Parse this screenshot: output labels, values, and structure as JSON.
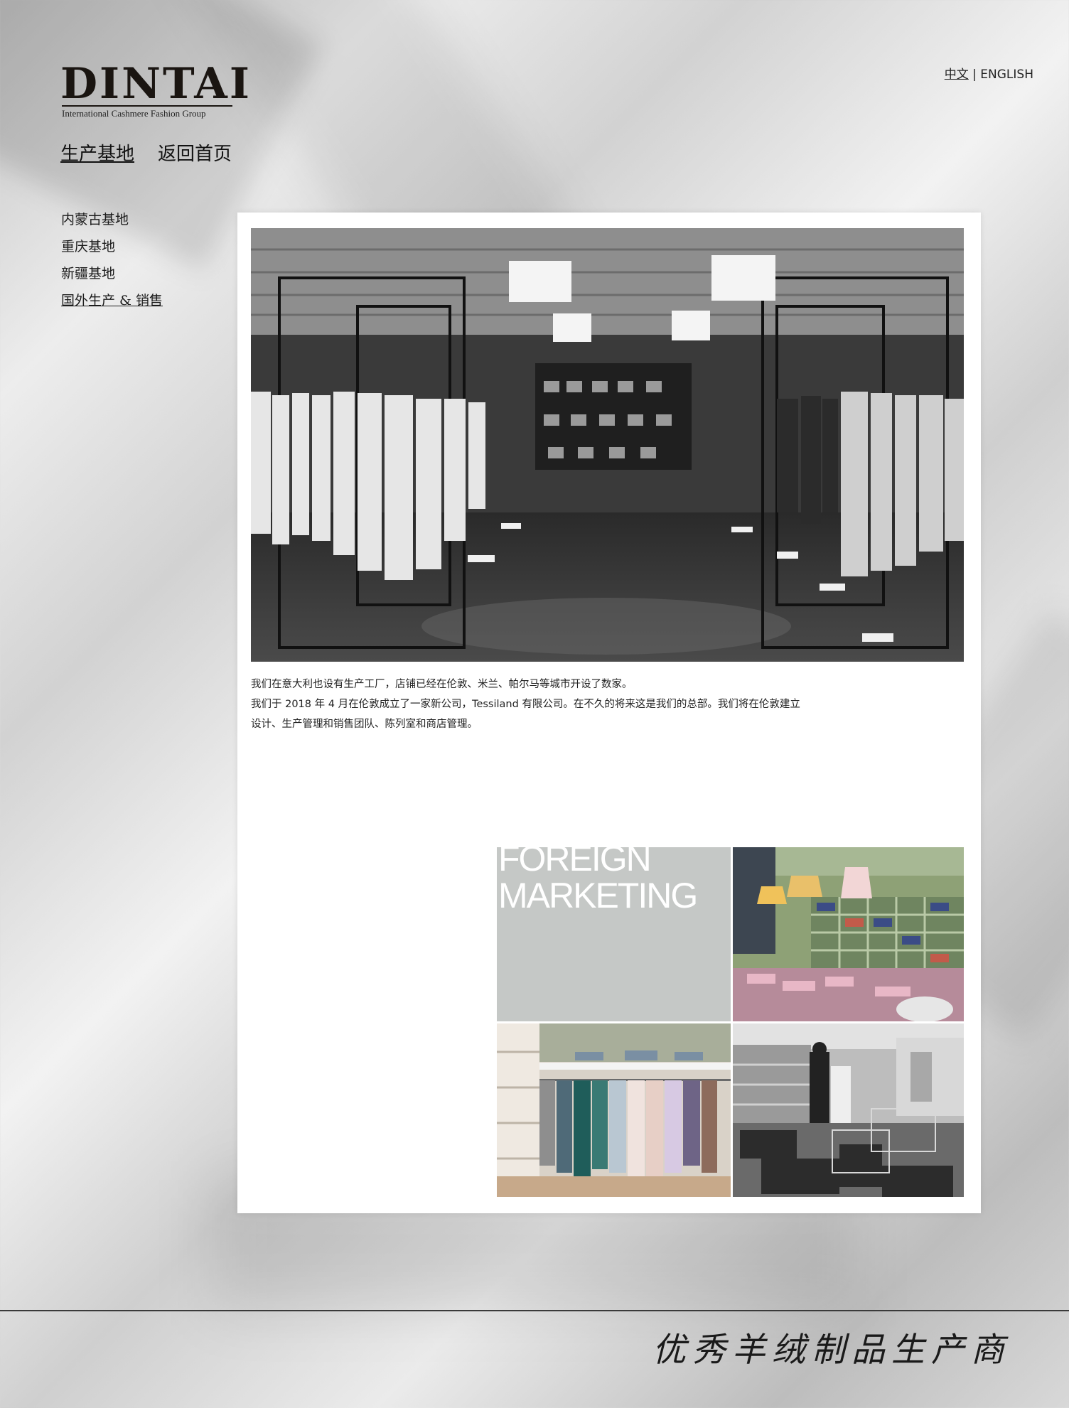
{
  "brand": {
    "name": "DINTAI",
    "tagline": "International Cashmere Fashion Group"
  },
  "language": {
    "chinese": "中文",
    "separator": "|",
    "english": "ENGLISH"
  },
  "nav": {
    "items": [
      {
        "label": "生产基地",
        "active": true
      },
      {
        "label": "返回首页",
        "active": false
      }
    ]
  },
  "sidebar": {
    "items": [
      {
        "label": "内蒙古基地"
      },
      {
        "label": "重庆基地"
      },
      {
        "label": "新疆基地"
      },
      {
        "label": "国外生产 & 销售",
        "current": true
      }
    ]
  },
  "content": {
    "paragraphs": [
      "我们在意大利也设有生产工厂，店铺已经在伦敦、米兰、帕尔马等城市开设了数家。",
      "我们于 2018 年 4 月在伦敦成立了一家新公司，Tessiland 有限公司。在不久的将来这是我们的总部。我们将在伦敦建立",
      "设计、生产管理和销售团队、陈列室和商店管理。"
    ],
    "marketing_tile": {
      "line1": "FOREIGN",
      "line2": "MARKETING"
    }
  },
  "footer": {
    "slogan": "优秀羊绒制品生产商"
  }
}
